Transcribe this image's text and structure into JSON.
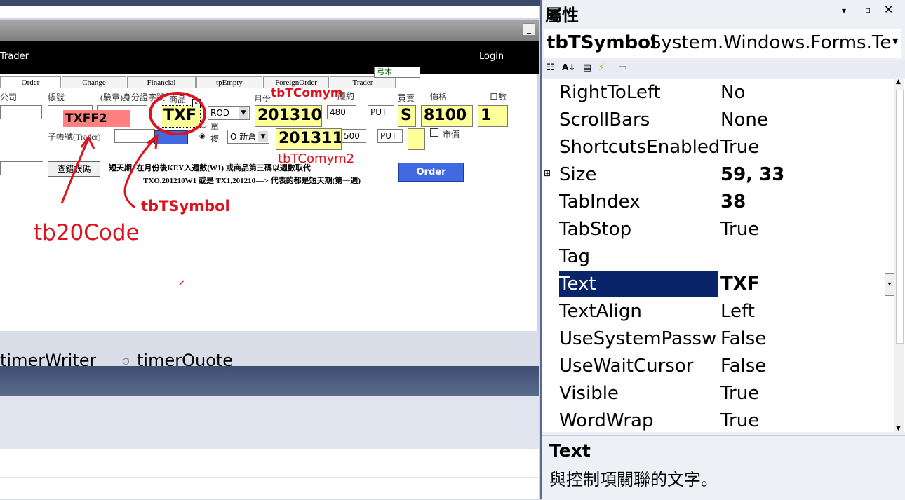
{
  "designer": {
    "form_header": {
      "left_title": "Trader",
      "login": "Login"
    },
    "tabs": [
      "Order",
      "Change",
      "Financial",
      "tpEmpty",
      "ForeignOrder",
      "Trader"
    ],
    "hint_box": "弓木",
    "labels": {
      "company": "公司",
      "account": "帳號",
      "id_label": "(驗章)身分證字號",
      "product": "商品",
      "month": "月份",
      "strike": "履約",
      "buysell": "買賣",
      "price": "價格",
      "qty": "口數",
      "sub_account": "子帳號(Trader)",
      "single": "單",
      "multi": "複",
      "market_price": "市價",
      "query_button": "查錯誤碼",
      "note_line1": "短天期: 在月份後KEY入週數(W1) 或商品第三碼以週數取代",
      "note_line2": "TXO,201210W1 或是 TX1,201210==> 代表的都是短天期(第一週)"
    },
    "fields": {
      "tb20code": "TXFF2",
      "symbol": "TXF",
      "rod": "ROD",
      "comym": "201310",
      "strike1": "480",
      "put1": "PUT",
      "side": "S",
      "price": "8100",
      "qty": "1",
      "offset": "O 新倉",
      "comym2": "201311",
      "strike2": "500",
      "put2": "PUT"
    },
    "order_button": "Order",
    "annotations": {
      "tbTComym": "tbTComym",
      "tbTComym2": "tbTComym2",
      "tbTSymbol": "tbTSymbol",
      "tb20Code": "tb20Code"
    },
    "components": {
      "timer1": "timerWriter",
      "timer2": "timerQuote"
    }
  },
  "properties_panel": {
    "title": "屬性",
    "object_name": "tbTSymbol",
    "object_type": "System.Windows.Forms.TextBox",
    "rows": [
      {
        "name": "RightToLeft",
        "value": "No",
        "bold": false
      },
      {
        "name": "ScrollBars",
        "value": "None",
        "bold": false
      },
      {
        "name": "ShortcutsEnabled",
        "value": "True",
        "bold": false
      },
      {
        "name": "Size",
        "value": "59, 33",
        "bold": true,
        "expandable": true
      },
      {
        "name": "TabIndex",
        "value": "38",
        "bold": true
      },
      {
        "name": "TabStop",
        "value": "True",
        "bold": false
      },
      {
        "name": "Tag",
        "value": "",
        "bold": false
      },
      {
        "name": "Text",
        "value": "TXF",
        "bold": true,
        "selected": true
      },
      {
        "name": "TextAlign",
        "value": "Left",
        "bold": false
      },
      {
        "name": "UseSystemPasswordChar",
        "value": "False",
        "bold": false
      },
      {
        "name": "UseWaitCursor",
        "value": "False",
        "bold": false
      },
      {
        "name": "Visible",
        "value": "True",
        "bold": false
      },
      {
        "name": "WordWrap",
        "value": "True",
        "bold": false
      }
    ],
    "description_title": "Text",
    "description_text": "與控制項關聯的文字。",
    "colors": {
      "selected_row": "#0a246a",
      "annotation": "#e0101c",
      "field_yellow": "#ffff99"
    }
  }
}
